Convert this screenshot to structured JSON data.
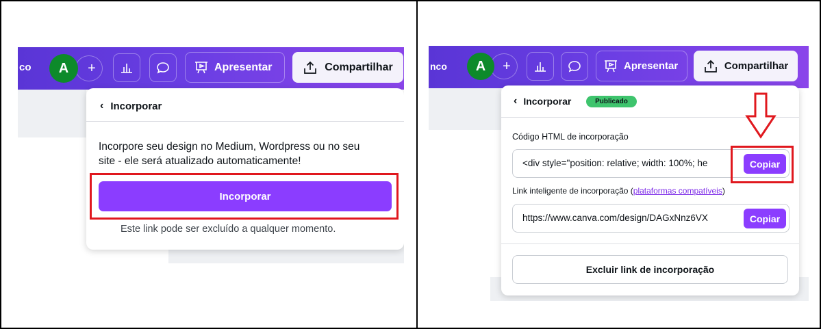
{
  "colors": {
    "accent": "#8b3dff",
    "topbar": "#6a3ee3",
    "highlight": "#e0181e",
    "published": "#3ec46d",
    "avatar": "#0d8a2a"
  },
  "left": {
    "topbar": {
      "cut_text": "co",
      "avatar_letter": "A",
      "add_icon": "+",
      "present_label": "Apresentar",
      "share_label": "Compartilhar"
    },
    "card": {
      "back_label": "Incorporar",
      "description_line1": "Incorpore seu design no Medium, Wordpress ou no seu",
      "description_line2": "site - ele será atualizado automaticamente!",
      "button_label": "Incorporar",
      "footnote": "Este link pode ser excluído a qualquer momento."
    }
  },
  "right": {
    "topbar": {
      "cut_text": "nco",
      "avatar_letter": "A",
      "add_icon": "+",
      "present_label": "Apresentar",
      "share_label": "Compartilhar"
    },
    "card": {
      "back_label": "Incorporar",
      "badge": "Publicado",
      "html_label": "Código HTML de incorporação",
      "html_value": "<div style=\"position: relative; width: 100%; he",
      "copy_label_1": "Copiar",
      "smart_link_label": "Link inteligente de incorporação (",
      "smart_link_anchor": "plataformas compatíveis",
      "smart_link_close": ")",
      "smart_link_value": "https://www.canva.com/design/DAGxNnz6VX",
      "copy_label_2": "Copiar",
      "delete_label": "Excluir link de incorporação"
    }
  }
}
